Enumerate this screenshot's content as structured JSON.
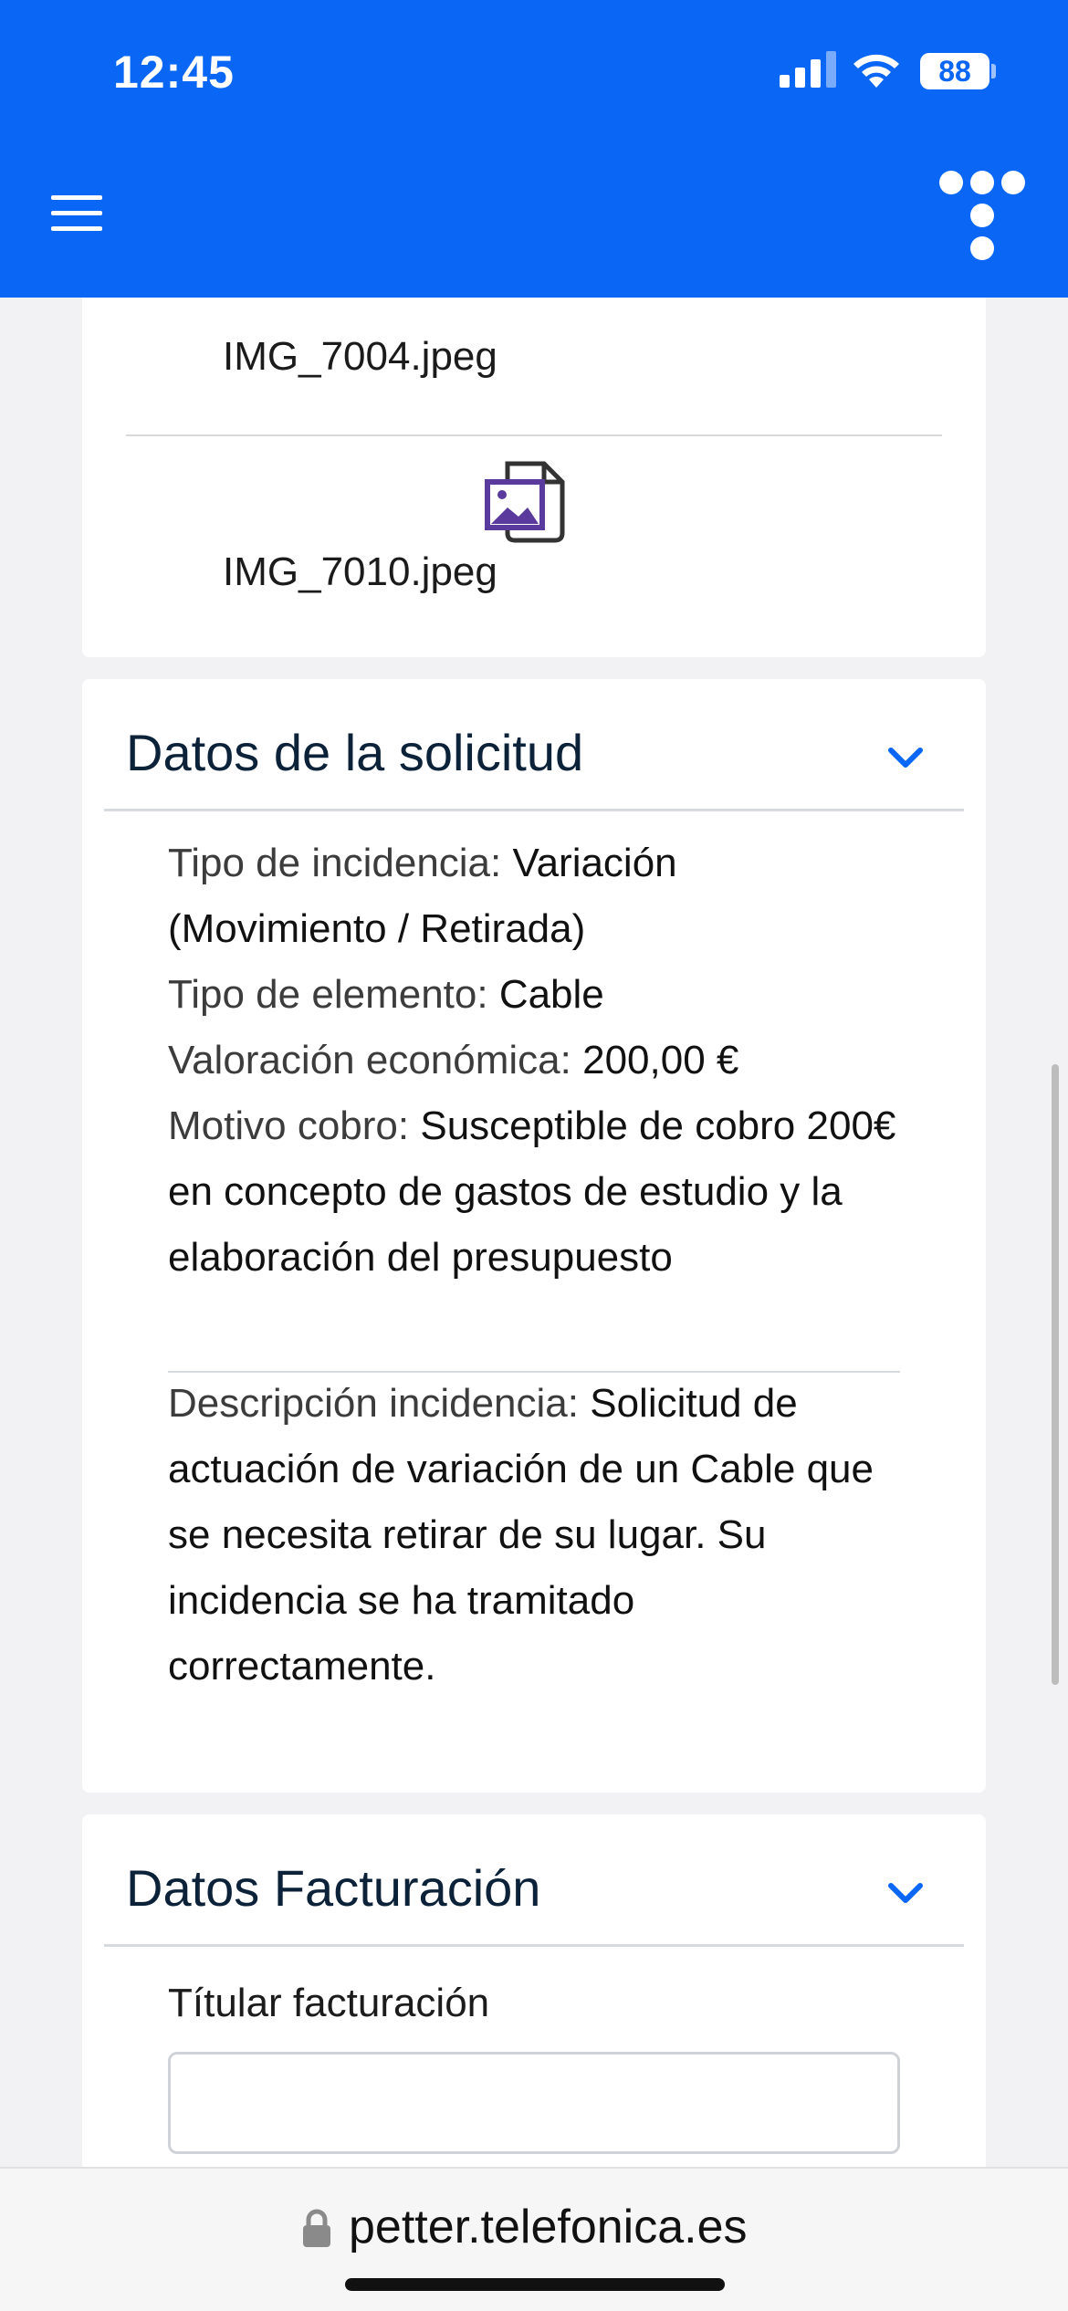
{
  "status_bar": {
    "time": "12:45",
    "battery": "88"
  },
  "attachments": [
    {
      "file_name": "IMG_7004.jpeg"
    },
    {
      "file_name": "IMG_7010.jpeg"
    }
  ],
  "solicitud": {
    "title": "Datos de la solicitud",
    "tipo_incidencia_label": "Tipo de incidencia: ",
    "tipo_incidencia_value": "Variación (Movimiento / Retirada)",
    "tipo_elemento_label": "Tipo de elemento: ",
    "tipo_elemento_value": "Cable",
    "valoracion_label": "Valoración económica: ",
    "valoracion_value": "200,00 €",
    "motivo_label": "Motivo cobro: ",
    "motivo_value": "Susceptible de cobro 200€ en concepto de gastos de estudio y la elaboración del presupuesto",
    "descripcion_label": "Descripción incidencia: ",
    "descripcion_value": "Solicitud de actuación de variación de un Cable que se necesita retirar de su lugar. Su incidencia se ha tramitado correctamente."
  },
  "facturacion": {
    "title": "Datos Facturación",
    "titular_label": "Títular facturación",
    "titular_value": ""
  },
  "browser": {
    "url": "petter.telefonica.es"
  },
  "colors": {
    "brand_blue": "#0a66f5",
    "file_icon_purple": "#5b3a9e"
  }
}
